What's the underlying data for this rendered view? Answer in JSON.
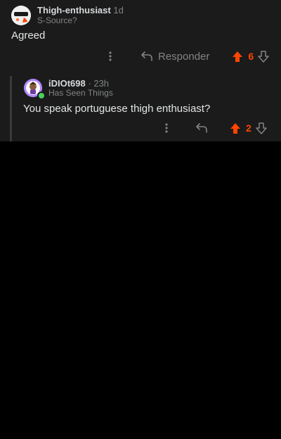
{
  "comment1": {
    "username": "Thigh-enthusiast",
    "time": "1d",
    "flair": "S-Source?",
    "body": "Agreed",
    "reply_label": "Responder",
    "votes": "6"
  },
  "comment2": {
    "username": "iDIOt698",
    "time": "23h",
    "flair": "Has Seen Things",
    "body": "You speak portuguese thigh enthusiast?",
    "votes": "2"
  },
  "colors": {
    "upvote": "#ff4500",
    "muted": "#818384",
    "background": "#1b1b1b",
    "online": "#46d160"
  },
  "icons": [
    "more-options-icon",
    "reply-icon",
    "upvote-icon",
    "downvote-icon",
    "avatar-icon",
    "online-status-icon"
  ]
}
